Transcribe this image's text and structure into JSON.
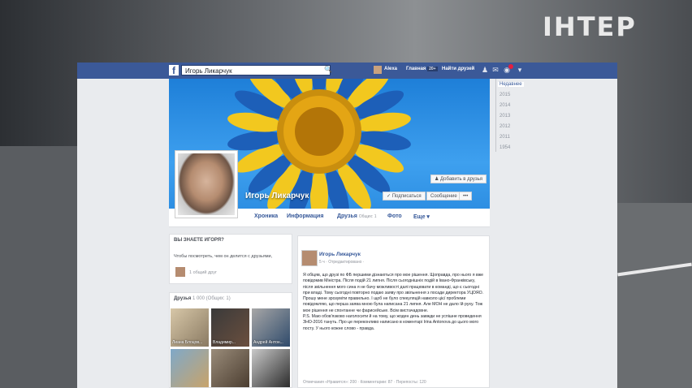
{
  "broadcast": {
    "logo": "IНТЕР"
  },
  "topbar": {
    "fb_logo": "f",
    "search_value": "Игорь Ликарчук",
    "profile_link": "Alexa",
    "home_link": "Главная",
    "home_badge": "20+",
    "find_friends": "Найти друзей"
  },
  "profile": {
    "name": "Игорь Ликарчук",
    "add_friend": "Добавить в друзья",
    "follow": "Подписаться",
    "message": "Сообщение",
    "more": "•••"
  },
  "tabs": [
    {
      "label": "Хроника"
    },
    {
      "label": "Информация"
    },
    {
      "label": "Друзья",
      "count": "Общих: 1"
    },
    {
      "label": "Фото"
    },
    {
      "label": "Еще ▾"
    }
  ],
  "timeline_years": [
    "Недавнее",
    "2015",
    "2014",
    "2013",
    "2012",
    "2011",
    "1954"
  ],
  "know_card": {
    "title": "ВЫ ЗНАЕТЕ ИГОРЯ?",
    "text": "Чтобы посмотреть, чем он делится с друзьями,",
    "mutual": "1 общий друг"
  },
  "friends_card": {
    "title": "Друзья",
    "count": "1 000 (Общих: 1)",
    "names": [
      "Лиана Блоцов...",
      "Владимир...",
      "Андрей Антон...",
      "",
      "",
      ""
    ]
  },
  "post": {
    "author": "Игорь Ликарчук",
    "meta": "5 ч · Отредактировано ·",
    "text": "Я обіцяв, що друзі по ФБ першими дізнаються про мое рішення. Щоправда, про нього я вже повідомив Міністра. Після подій 21 липня. Після сьогоднішніх подій в Івано-Франківську, після звільнення мого сина я не бачу можливості далі працювати в команді, що є сьогодні при владі. Тому сьогодні повторно подаю заяву про звільнення з посади директора УЦОЯО. Прошу мене зрозуміти правильно. І щоб не було спекуляцій навколо цієї проблеми повідомляю, що перша заява мною була написана 21 липня. Але МОН не дало їй руху. Тож мое рішення не спонтанне чи фарисейське. Всім вистачадовне.\nP.S. Маю обов'язково наголосити й на тому, що жоден день завжди не успішне проведення ЗНО-2016 тануть. Про це переконливо написано в коментарі Irina Antonova до цього мого посту. У нього кожне слово - правда.",
    "stats": "Отмечания «Нравится»: 200 · Комментарии: 87 · Перепосты: 120"
  }
}
